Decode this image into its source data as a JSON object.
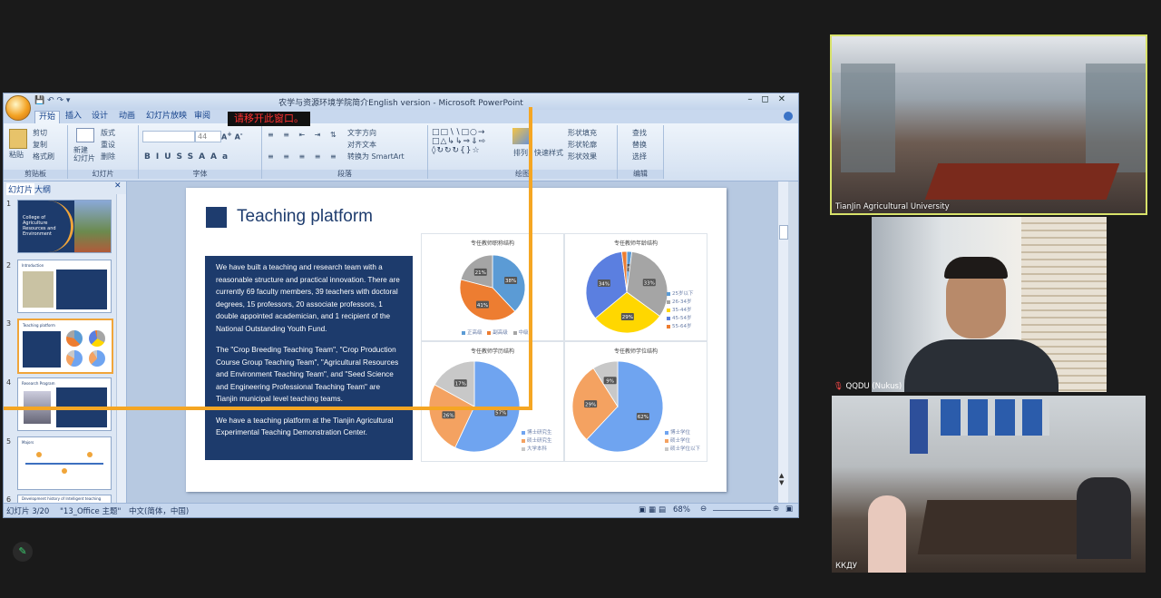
{
  "ppt": {
    "window_title": "农学与资源环境学院简介English version - Microsoft PowerPoint",
    "tabs": [
      "开始",
      "插入",
      "设计",
      "动画",
      "幻灯片放映",
      "审阅"
    ],
    "overlay_notice": "请移开此窗口。",
    "ribbon": {
      "clipboard": {
        "paste": "粘贴",
        "cut": "剪切",
        "copy": "复制",
        "format_painter": "格式刷",
        "label": "剪贴板"
      },
      "slides": {
        "new_slide": "新建\n幻灯片",
        "layout": "版式",
        "reset": "重设",
        "delete": "删除",
        "label": "幻灯片"
      },
      "font": {
        "size": "44",
        "label": "字体"
      },
      "paragraph": {
        "text_direction": "文字方向",
        "align_text": "对齐文本",
        "smartart": "转换为 SmartArt",
        "label": "段落"
      },
      "drawing": {
        "arrange": "排列",
        "quick_styles": "快速样式",
        "shape_fill": "形状填充",
        "shape_outline": "形状轮廓",
        "shape_effects": "形状效果",
        "label": "绘图"
      },
      "editing": {
        "find": "查找",
        "replace": "替换",
        "select": "选择",
        "label": "编辑"
      }
    },
    "left_panel": {
      "tabs": [
        "幻灯片",
        "大纲"
      ],
      "thumb_numbers": [
        "1",
        "2",
        "3",
        "4",
        "5",
        "6"
      ],
      "thumb1_text": "College of Agriculture Resources and Environment",
      "thumb2_text": "Introduction",
      "thumb3_text": "Teaching platform",
      "thumb4_text": "Research Program",
      "thumb5_text": "Majors",
      "thumb6_text": "Development history of Intelligent teaching"
    },
    "slide": {
      "title": "Teaching platform",
      "para1": "We have built a teaching and research team with a reasonable structure and practical innovation. There are currently 69 faculty members, 39 teachers with doctoral degrees, 15 professors, 20 associate professors, 1 double appointed academician, and 1 recipient of the National Outstanding Youth Fund.",
      "para2": "The \"Crop Breeding Teaching Team\", \"Crop Production Course Group Teaching Team\", \"Agricultural Resources and Environment Teaching Team\", and \"Seed Science and Engineering Professional Teaching Team\" are Tianjin municipal level teaching teams.",
      "para3": "We have a teaching platform at the Tianjin Agricultural Experimental Teaching Demonstration Center."
    },
    "status": {
      "slide": "幻灯片 3/20",
      "theme": "\"13_Office 主题\"",
      "lang": "中文(简体，中国)",
      "zoom": "68%"
    }
  },
  "chart_data": [
    {
      "type": "pie",
      "title": "专任教师职称结构",
      "categories": [
        "正高级",
        "副高级",
        "中级"
      ],
      "values": [
        38,
        41,
        21
      ],
      "labels": [
        "38%",
        "41%",
        "21%"
      ],
      "colors": [
        "#5b9bd5",
        "#ed7d31",
        "#a5a5a5"
      ],
      "legend": "bottom"
    },
    {
      "type": "pie",
      "title": "专任教师年龄结构",
      "categories": [
        "25岁以下",
        "26-34岁",
        "35-44岁",
        "45-54岁",
        "55-64岁"
      ],
      "values": [
        2,
        33,
        29,
        34,
        2
      ],
      "labels": [
        "2%",
        "33%",
        "29%",
        "34%",
        ""
      ],
      "colors": [
        "#5b9bd5",
        "#a5a5a5",
        "#ffd700",
        "#5b7fe0",
        "#ed7d31"
      ],
      "legend": "right"
    },
    {
      "type": "pie",
      "title": "专任教师学历结构",
      "categories": [
        "博士研究生",
        "硕士研究生",
        "大学本科"
      ],
      "values": [
        57,
        26,
        17
      ],
      "labels": [
        "57%",
        "26%",
        "17%"
      ],
      "colors": [
        "#6fa4f0",
        "#f4a261",
        "#c8c8c8"
      ],
      "legend": "right"
    },
    {
      "type": "pie",
      "title": "专任教师学位结构",
      "categories": [
        "博士学位",
        "硕士学位",
        "硕士学位以下"
      ],
      "values": [
        62,
        29,
        9
      ],
      "labels": [
        "62%",
        "29%",
        "9%"
      ],
      "colors": [
        "#6fa4f0",
        "#f4a261",
        "#c8c8c8"
      ],
      "legend": "right"
    }
  ],
  "videos": [
    {
      "label": "TianJin Agricultural University"
    },
    {
      "label": "QQDU (Nukus)"
    },
    {
      "label": "ККДУ"
    }
  ],
  "colors": {
    "accent_border": "#d8e26a",
    "orange_annotation": "#f5a623",
    "slide_navy": "#1d3b6c"
  }
}
